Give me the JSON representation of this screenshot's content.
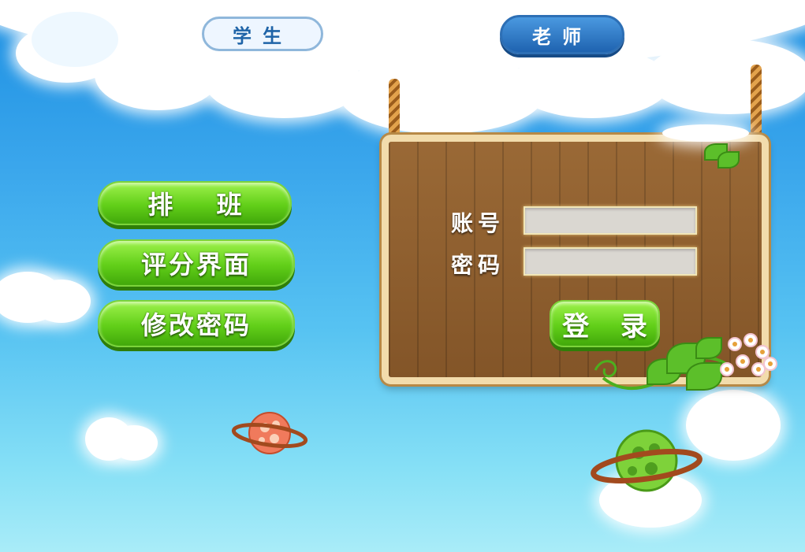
{
  "tabs": {
    "student": "学生",
    "teacher": "老师"
  },
  "menu": {
    "schedule": "排 班",
    "scoring": "评分界面",
    "change_password": "修改密码"
  },
  "login": {
    "account_label": "账号",
    "password_label": "密码",
    "account_value": "",
    "password_value": "",
    "submit_label": "登 录"
  },
  "colors": {
    "sky": "#3aa6ec",
    "green_button": "#62cf19",
    "wood": "#8a5a2b",
    "teacher_tab": "#1f63b0"
  },
  "icons": {
    "planet_left": "orange-planet-icon",
    "planet_right": "green-planet-icon",
    "vine": "vine-decoration"
  }
}
